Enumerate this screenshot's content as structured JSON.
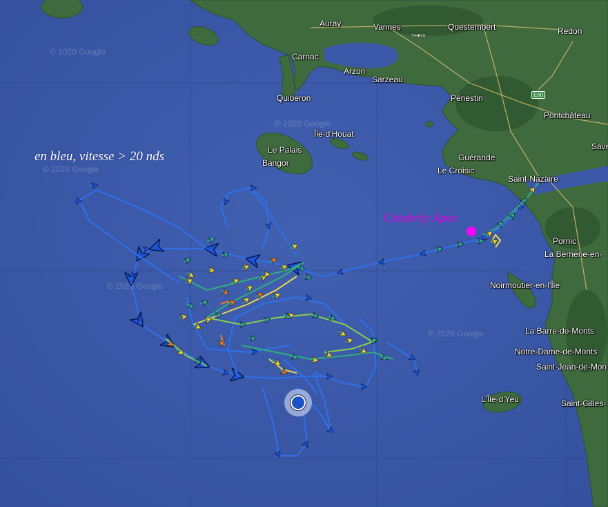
{
  "map": {
    "caption": "en bleu, vitesse > 20 nds",
    "vessel_label": "Celebrity Apex",
    "watermark": "© 2020 Google",
    "road_badge": "E60",
    "theix_label": "THEIX",
    "places": {
      "auray": "Auray",
      "vannes": "Vannes",
      "questembert": "Questembert",
      "redon": "Redon",
      "carnac": "Carnac",
      "arzon": "Arzon",
      "sarzeau": "Sarzeau",
      "quiberon": "Quiberon",
      "penestin": "Pénestin",
      "pontchateau": "Pontchâteau",
      "ile_houat": "Île-d'Houat",
      "le_palais": "Le Palais",
      "bangor": "Bangor",
      "savenay": "Save",
      "guerande": "Guérande",
      "le_croisic": "Le Croisic",
      "saint_nazaire": "Saint-Nazaire",
      "pornic": "Pornic",
      "la_bernerie": "La Bernerie-en-",
      "noirmoutier": "Noirmoutier-en-l'Île",
      "la_barre_de_monts": "La Barre-de-Monts",
      "notre_dame_de_monts": "Notre-Dame-de-Monts",
      "saint_jean_de_monts": "Saint-Jean-de-Mon",
      "ile_yeu": "L'Île-d'Yeu",
      "saint_gilles": "Saint-Gilles-"
    },
    "colors": {
      "sea": "#3b57a8",
      "land": "#3f6a3e",
      "track_fast": "#2f6fe8",
      "speed_mid": "#2fb07a",
      "speed_slow": "#e8d84a",
      "speed_very_slow": "#e04a2a",
      "vessel": "#ff00ff"
    }
  }
}
